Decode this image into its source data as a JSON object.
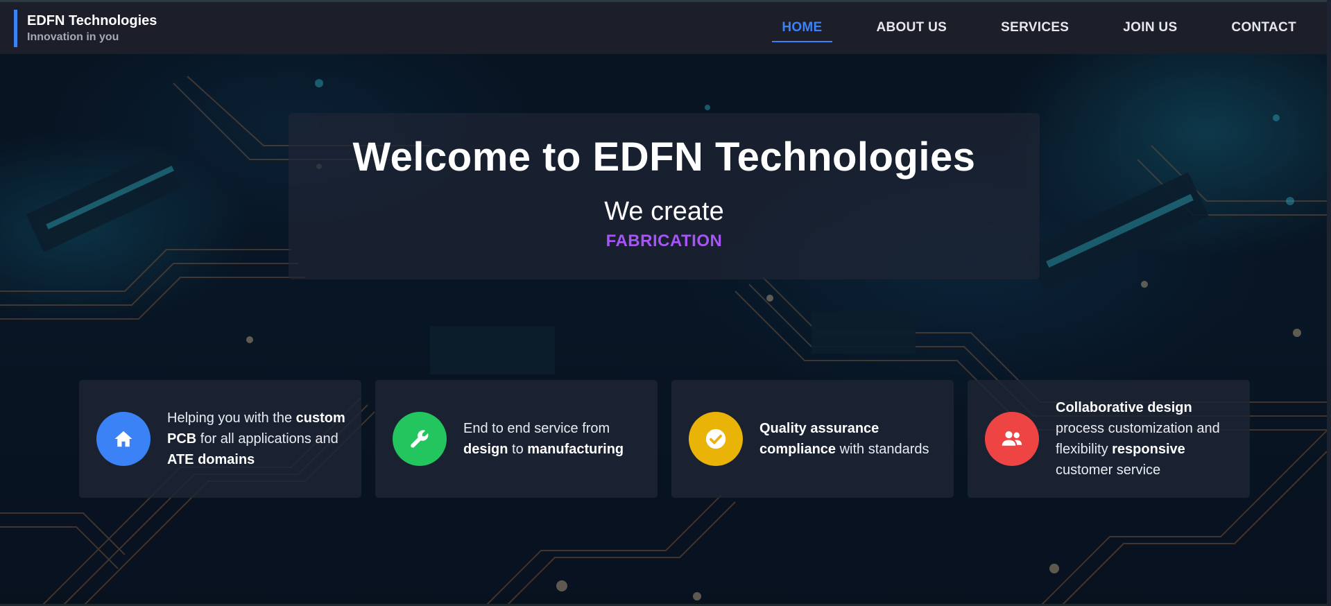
{
  "brand": {
    "name": "EDFN Technologies",
    "tagline": "Innovation in you",
    "accent_color": "#3b82f6"
  },
  "nav": {
    "items": [
      {
        "label": "HOME",
        "active": true
      },
      {
        "label": "ABOUT US",
        "active": false
      },
      {
        "label": "SERVICES",
        "active": false
      },
      {
        "label": "JOIN US",
        "active": false
      },
      {
        "label": "CONTACT",
        "active": false
      }
    ]
  },
  "hero": {
    "title": "Welcome to EDFN Technologies",
    "subtitle": "We create",
    "rotating_word": "FABRICATION",
    "rotating_word_color": "#a855f7"
  },
  "features": [
    {
      "icon": "home-icon",
      "icon_color": "#3b82f6",
      "parts": [
        {
          "text": "Helping you with the ",
          "bold": false
        },
        {
          "text": "custom PCB",
          "bold": true
        },
        {
          "text": " for all applications and ",
          "bold": false
        },
        {
          "text": "ATE domains",
          "bold": true
        }
      ]
    },
    {
      "icon": "wrench-icon",
      "icon_color": "#22c55e",
      "parts": [
        {
          "text": "End to end service from ",
          "bold": false
        },
        {
          "text": "design",
          "bold": true
        },
        {
          "text": " to ",
          "bold": false
        },
        {
          "text": "manufacturing",
          "bold": true
        }
      ]
    },
    {
      "icon": "check-circle-icon",
      "icon_color": "#eab308",
      "parts": [
        {
          "text": "Quality assurance compliance",
          "bold": true
        },
        {
          "text": " with standards",
          "bold": false
        }
      ]
    },
    {
      "icon": "users-icon",
      "icon_color": "#ef4444",
      "parts": [
        {
          "text": "Collaborative design",
          "bold": true
        },
        {
          "text": " process customization and flexibility ",
          "bold": false
        },
        {
          "text": "responsive",
          "bold": true
        },
        {
          "text": " customer service",
          "bold": false
        }
      ]
    }
  ]
}
